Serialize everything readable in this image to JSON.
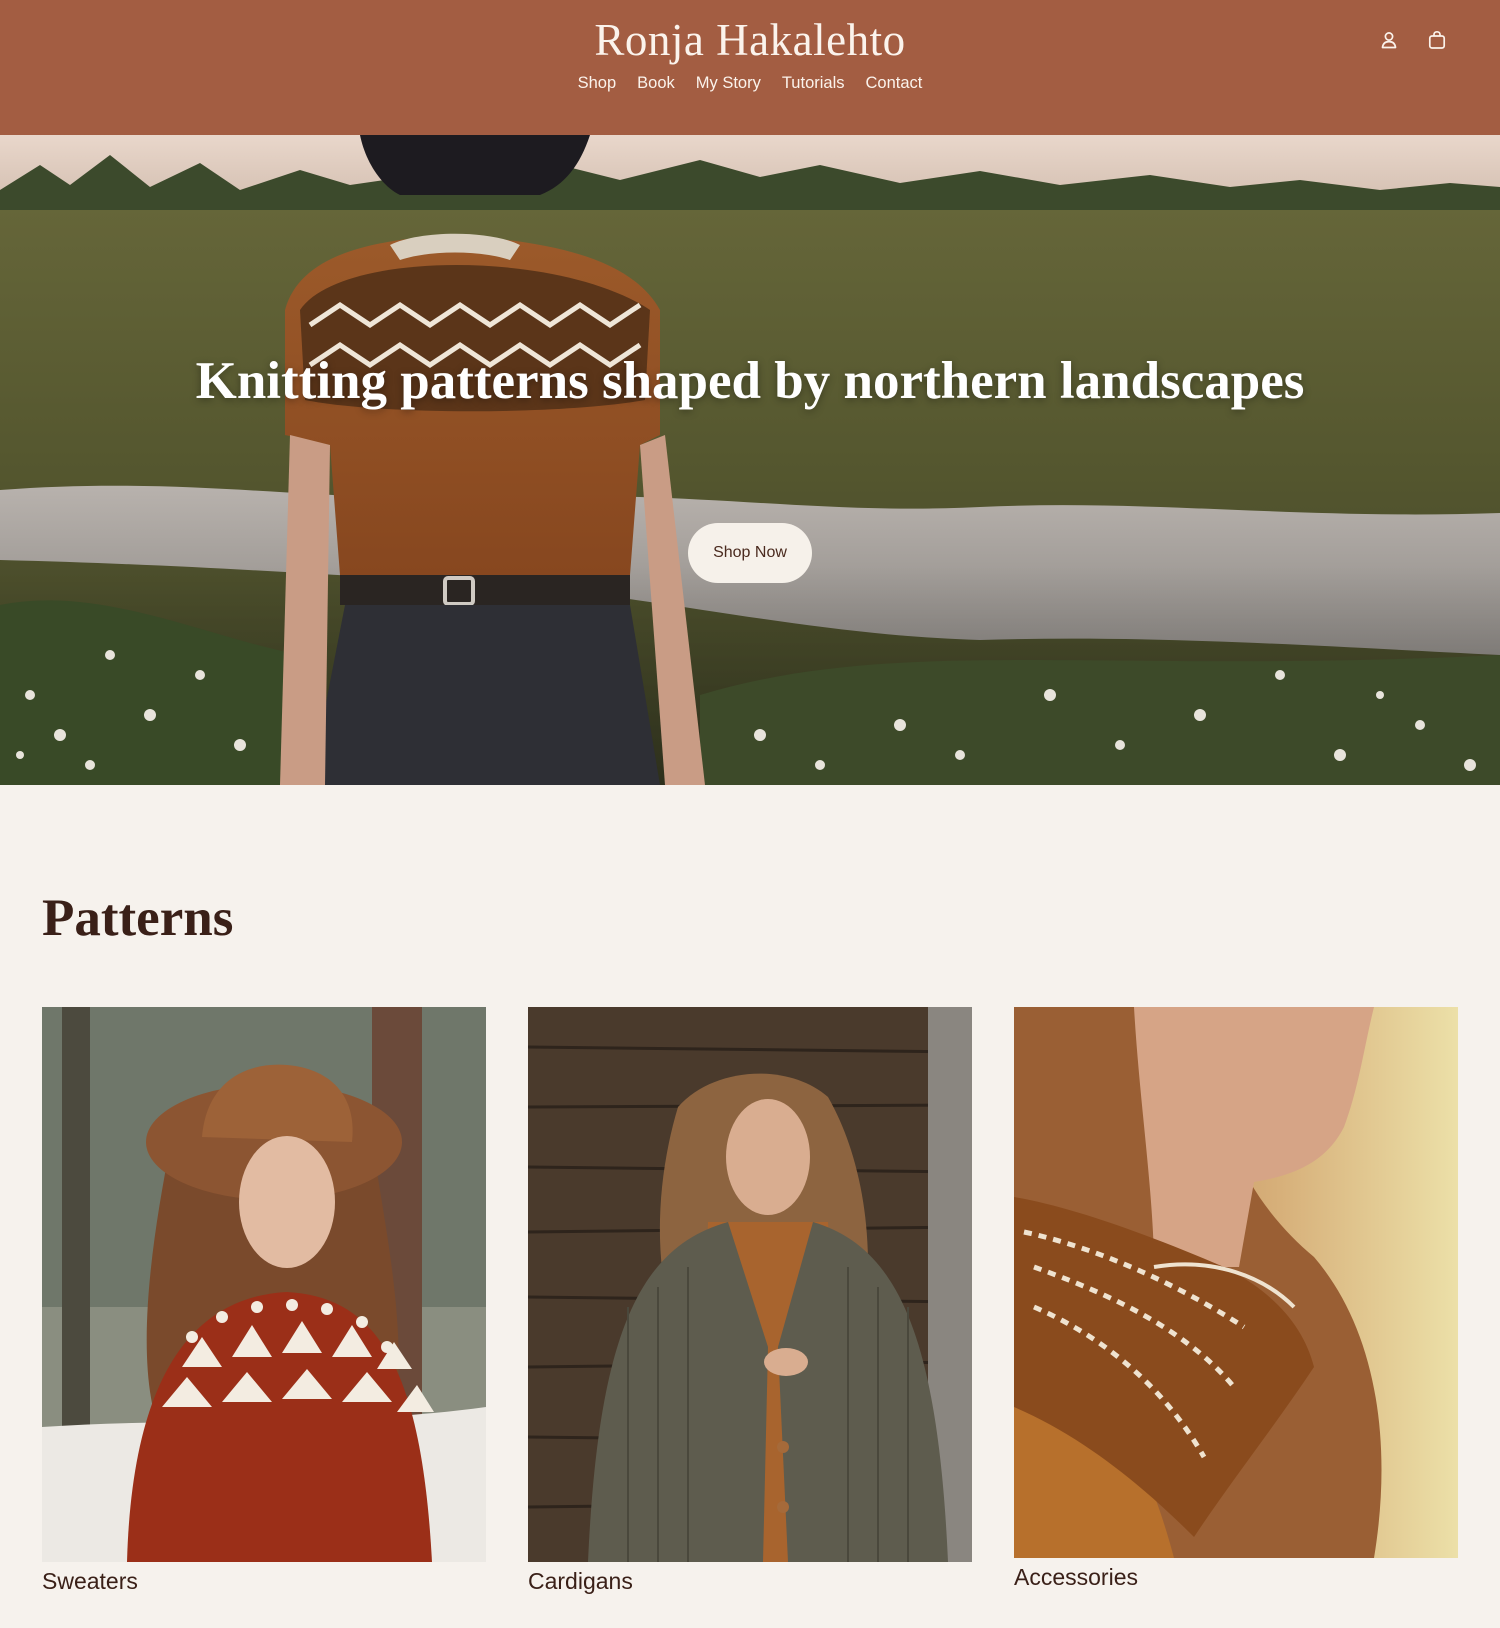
{
  "header": {
    "brand": "Ronja Hakalehto",
    "nav": [
      "Shop",
      "Book",
      "My Story",
      "Tutorials",
      "Contact"
    ],
    "icons": [
      "account-icon",
      "cart-icon"
    ],
    "background_color": "#a35d42"
  },
  "hero": {
    "title": "Knitting patterns shaped by northern landscapes",
    "cta_label": "Shop Now"
  },
  "patterns": {
    "title": "Patterns",
    "categories": [
      {
        "label": "Sweaters"
      },
      {
        "label": "Cardigans"
      },
      {
        "label": "Accessories"
      }
    ]
  },
  "colors": {
    "page_background": "#f6f2ed",
    "text_dark": "#3a2018",
    "button_background": "#f6f1ea"
  }
}
